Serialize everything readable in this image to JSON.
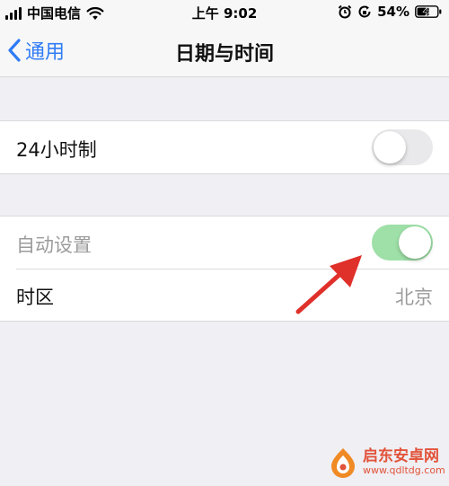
{
  "status_bar": {
    "carrier": "中国电信",
    "time": "上午 9:02",
    "battery": "54%",
    "icons": [
      "signal-icon",
      "wifi-icon",
      "alarm-icon",
      "orientation-lock-icon",
      "battery-charging-icon"
    ]
  },
  "nav": {
    "back_label": "通用",
    "title": "日期与时间",
    "back_icon": "chevron-left-icon"
  },
  "settings": {
    "hour24": {
      "label": "24小时制",
      "enabled": false
    },
    "auto_set": {
      "label": "自动设置",
      "enabled": true
    },
    "timezone": {
      "label": "时区",
      "value": "北京"
    }
  },
  "watermark": {
    "name": "启东安卓网",
    "url": "www.qdltdg.com"
  },
  "colors": {
    "accent": "#2f7cf6",
    "toggle_on": "#9ee0a7",
    "toggle_off": "#e9e9eb",
    "arrow": "#e0302a",
    "background": "#efeff4"
  }
}
